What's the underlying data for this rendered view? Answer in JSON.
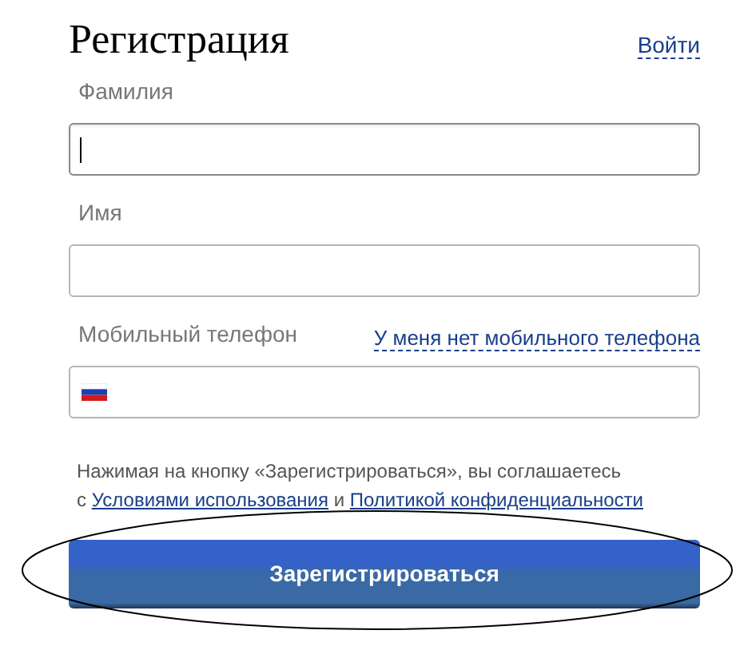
{
  "title": "Регистрация",
  "login_link": "Войти",
  "fields": [
    {
      "label": "Фамилия",
      "kind": "text",
      "focused": true
    },
    {
      "label": "Имя",
      "kind": "text",
      "focused": false
    },
    {
      "label": "Мобильный телефон",
      "kind": "phone",
      "focused": false,
      "link": "У меня нет мобильного телефона"
    }
  ],
  "agreement": {
    "line1": "Нажимая на кнопку «Зарегистрироваться», вы соглашаетесь",
    "prefix": "с",
    "terms_link": "Условиями использования",
    "conjunction": "и",
    "privacy_link": "Политикой конфиденциальности"
  },
  "submit_button": "Зарегистрироваться"
}
